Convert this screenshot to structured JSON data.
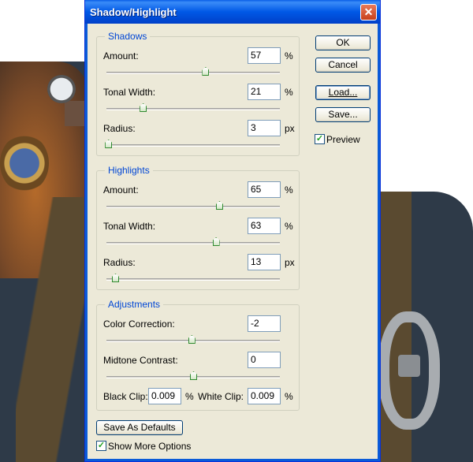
{
  "window": {
    "title": "Shadow/Highlight",
    "close_glyph": "✕"
  },
  "shadows": {
    "legend": "Shadows",
    "amount": {
      "label": "Amount:",
      "value": "57",
      "unit": "%",
      "level": 0.57
    },
    "tonal_width": {
      "label": "Tonal Width:",
      "value": "21",
      "unit": "%",
      "level": 0.21
    },
    "radius": {
      "label": "Radius:",
      "value": "3",
      "unit": "px",
      "level": 0.01
    }
  },
  "highlights": {
    "legend": "Highlights",
    "amount": {
      "label": "Amount:",
      "value": "65",
      "unit": "%",
      "level": 0.65
    },
    "tonal_width": {
      "label": "Tonal Width:",
      "value": "63",
      "unit": "%",
      "level": 0.63
    },
    "radius": {
      "label": "Radius:",
      "value": "13",
      "unit": "px",
      "level": 0.05
    }
  },
  "adjustments": {
    "legend": "Adjustments",
    "color_correction": {
      "label": "Color Correction:",
      "value": "-2",
      "level": 0.49
    },
    "midtone_contrast": {
      "label": "Midtone Contrast:",
      "value": "0",
      "level": 0.5
    },
    "black_clip": {
      "label": "Black Clip:",
      "value": "0.009",
      "unit": "%"
    },
    "white_clip": {
      "label": "White Clip:",
      "value": "0.009",
      "unit": "%"
    }
  },
  "buttons": {
    "ok": "OK",
    "cancel": "Cancel",
    "load": "Load...",
    "save": "Save...",
    "save_defaults": "Save As Defaults"
  },
  "preview": {
    "label": "Preview",
    "checked": true
  },
  "show_more": {
    "label": "Show More Options",
    "checked": true
  },
  "colors": {
    "title_blue": "#0058e6",
    "legend_blue": "#0046d5",
    "face": "#ece9d8"
  }
}
